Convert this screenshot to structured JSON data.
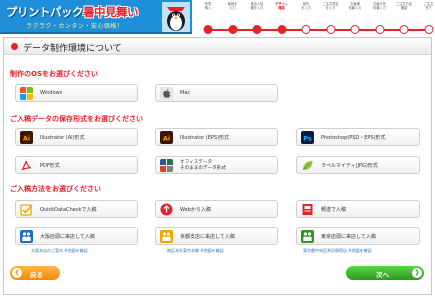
{
  "header": {
    "logo_main_a": "プリントパック",
    "logo_main_b": "暑中見舞い",
    "logo_sub": "ラクラク・カンタン・安心価格！"
  },
  "steps": [
    {
      "label": "年賀\n購入"
    },
    {
      "label": "絵柄を\n入力"
    },
    {
      "label": "差出人情\n報を入力"
    },
    {
      "label": "デザイン\n確認"
    },
    {
      "label": "宛先\nを入力"
    },
    {
      "label": "ご注文内容\nを入力"
    },
    {
      "label": "お客様\n情報入力"
    },
    {
      "label": "お届け先\n情報入力"
    },
    {
      "label": "ご注文方法\n確認"
    },
    {
      "label": "ご注文\n完了"
    }
  ],
  "panel": {
    "title": "データ制作環境について"
  },
  "sections": {
    "os_title": "制作のOSをお選びください",
    "format_title": "ご入稿データの保存形式をお選びください",
    "method_title": "ご入稿方法をお選びください"
  },
  "os": {
    "windows": "Windows",
    "mac": "Mac"
  },
  "formats": {
    "illustrator_ai": "Illustrator (AI)形式",
    "illustrator_eps": "Illustrator (EPS)形式",
    "photoshop": "Photoshop(PSD・EPS)形式",
    "pdf": "PDF形式",
    "office_line1": "オフィスデータ",
    "office_line2": "そのままのデータ形式",
    "rapid": "ラペルマイティ(JPG)形式"
  },
  "methods": {
    "quickdata": "QuickDataCheckで入稿",
    "web": "Webから入稿",
    "mail": "郵送で入稿",
    "osaka": "大阪店頭に来店して入稿",
    "kyoto": "京都支店に来店して入稿",
    "tokyo": "東京店頭に来店して入稿"
  },
  "links": {
    "osaka": "大阪本店のご案内 ※地図を確認",
    "kyoto": "南区本社東京本郷 ※地図を確認",
    "tokyo": "東京都中央区茶沢原宿店 ※地図を確認"
  },
  "buttons": {
    "back": "戻る",
    "next": "次へ"
  },
  "colors": {
    "accent": "#e8212b",
    "back_button": "#f28a06",
    "next_button": "#2a9c1d",
    "logo_blue": "#1e8fd8"
  }
}
